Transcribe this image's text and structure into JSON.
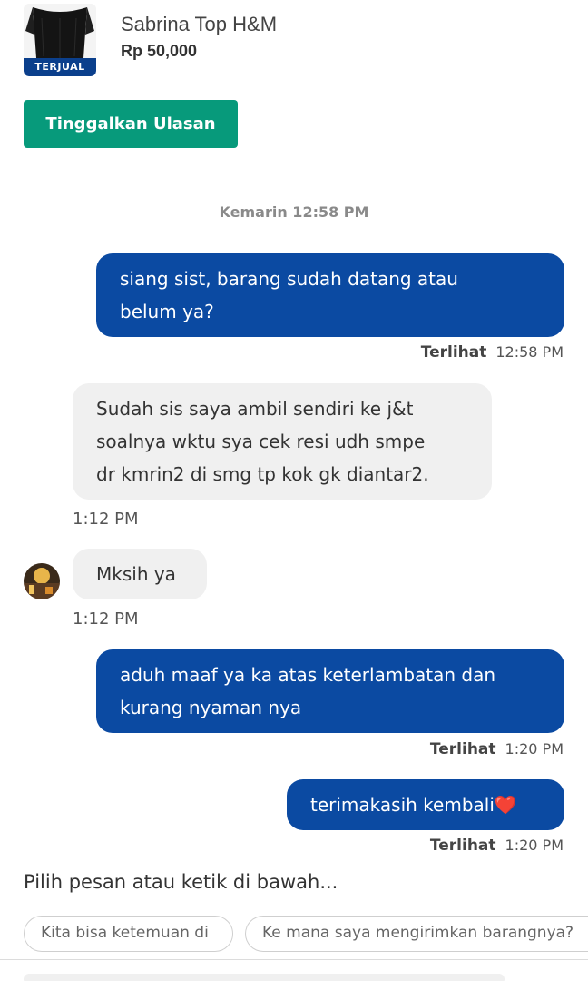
{
  "product": {
    "name": "Sabrina Top H&M",
    "price": "Rp 50,000",
    "badge": "TERJUAL"
  },
  "review_button": "Tinggalkan Ulasan",
  "date_separator": "Kemarin 12:58 PM",
  "messages": [
    {
      "side": "out",
      "lines": [
        "siang sist, barang sudah datang atau",
        "belum ya?"
      ],
      "status": "Terlihat",
      "time": "12:58 PM"
    },
    {
      "side": "in",
      "lines": [
        "Sudah sis saya ambil sendiri ke j&t",
        "soalnya wktu sya cek resi udh smpe",
        "dr kmrin2 di smg tp kok gk diantar2."
      ],
      "time": "1:12 PM"
    },
    {
      "side": "in",
      "lines": [
        "Mksih ya"
      ],
      "time": "1:12 PM"
    },
    {
      "side": "out",
      "lines": [
        "aduh maaf ya ka atas keterlambatan dan",
        "kurang nyaman nya"
      ],
      "status": "Terlihat",
      "time": "1:20 PM"
    },
    {
      "side": "out",
      "lines": [
        "terimakasih kembali❤️"
      ],
      "status": "Terlihat",
      "time": "1:20 PM"
    }
  ],
  "compose_hint": "Pilih pesan atau ketik di bawah...",
  "quick_replies": [
    "Kita bisa ketemuan di",
    "Ke mana saya mengirimkan barangnya?"
  ],
  "colors": {
    "outgoing_bubble": "#0b4aa2",
    "incoming_bubble": "#f0f0f0",
    "review_button": "#079a7b",
    "sold_badge": "#0b3f8c"
  }
}
